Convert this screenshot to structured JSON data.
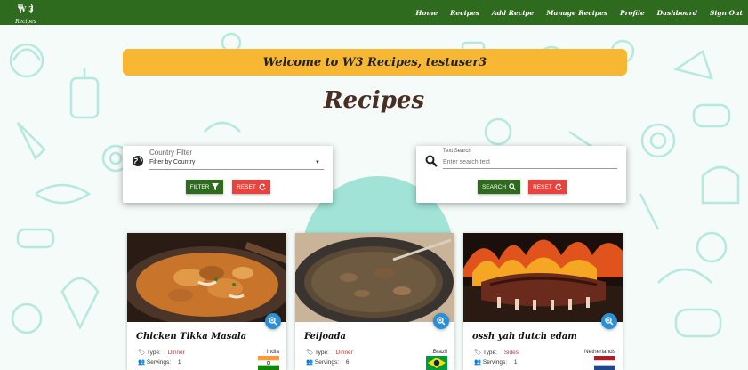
{
  "nav": {
    "logo_mark": "W 3",
    "logo_text": "Recipes",
    "links": [
      "Home",
      "Recipes",
      "Add Recipe",
      "Manage Recipes",
      "Profile",
      "Dashboard",
      "Sign Out"
    ]
  },
  "welcome": "Welcome to W3 Recipes, testuser3",
  "page_title": "Recipes",
  "country_filter": {
    "label": "Country Filter",
    "value": "Filter by Country",
    "filter_button": "Filter",
    "reset_button": "Reset"
  },
  "text_search": {
    "label": "Text Search",
    "placeholder": "Enter search text",
    "search_button": "Search",
    "reset_button": "Reset"
  },
  "recipes": [
    {
      "title": "Chicken Tikka Masala",
      "type_label": "Type:",
      "type": "Dinner",
      "servings_label": "Servings:",
      "servings": "1",
      "country": "India",
      "flag": "india-flag"
    },
    {
      "title": "Feijoada",
      "type_label": "Type:",
      "type": "Dinner",
      "servings_label": "Servings:",
      "servings": "6",
      "country": "Brazil",
      "flag": "brazil-flag"
    },
    {
      "title": "ossh yah dutch edam",
      "type_label": "Type:",
      "type": "Sides",
      "servings_label": "Servings:",
      "servings": "1",
      "country": "Netherlands",
      "flag": "netherlands-flag"
    }
  ],
  "colors": {
    "navbar": "#2f6b1f",
    "welcome_banner": "#f7b733",
    "title": "#4a2e22",
    "green_button": "#2f6b1f",
    "red_button": "#e8433d",
    "zoom_button": "#2b8fd6",
    "pattern": "#9fe3d4"
  }
}
